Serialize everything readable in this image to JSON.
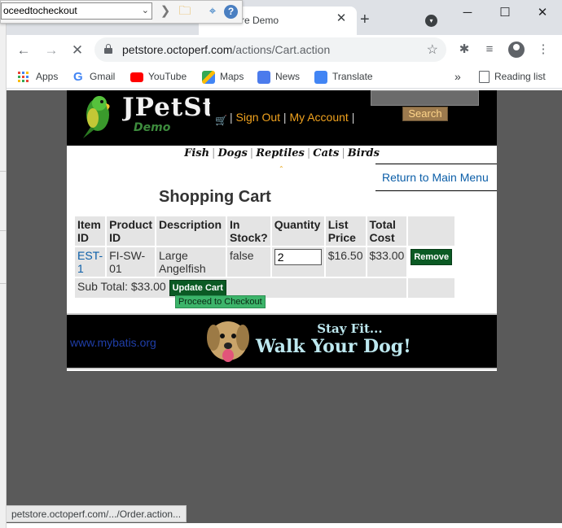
{
  "overlay": {
    "combo_value": "oceedtocheckout"
  },
  "browser": {
    "tab_title": "re Demo",
    "url_host": "petstore.octoperf.com",
    "url_path": "/actions/Cart.action",
    "bookmarks": [
      "Apps",
      "Gmail",
      "YouTube",
      "Maps",
      "News",
      "Translate"
    ],
    "more_label": "»",
    "reading_list": "Reading list",
    "status_url": "petstore.octoperf.com/.../Order.action..."
  },
  "header": {
    "logo_text": "JPetStore",
    "logo_sub": "Demo",
    "sign_out": "Sign Out",
    "my_account": "My Account",
    "sep": "|",
    "search_button": "Search"
  },
  "categories": [
    "Fish",
    "Dogs",
    "Reptiles",
    "Cats",
    "Birds"
  ],
  "return_link": "Return to Main Menu",
  "cart": {
    "title": "Shopping Cart",
    "columns": [
      "Item ID",
      "Product ID",
      "Description",
      "In Stock?",
      "Quantity",
      "List Price",
      "Total Cost",
      ""
    ],
    "rows": [
      {
        "item_id": "EST-1",
        "product_id": "FI-SW-01",
        "description": "Large Angelfish",
        "in_stock": "false",
        "quantity": "2",
        "list_price": "$16.50",
        "total_cost": "$33.00",
        "remove": "Remove"
      }
    ],
    "subtotal": "Sub Total: $33.00",
    "update_button": "Update Cart",
    "checkout_button": "Proceed to Checkout"
  },
  "footer": {
    "mybatis": "www.mybatis.org",
    "banner_line1": "Stay Fit...",
    "banner_line2": "Walk Your Dog!"
  },
  "colors": {
    "header_bg": "#000000",
    "link_orange": "#f0a21e",
    "link_blue": "#0b5ea8",
    "button_dark_green": "#0b5a24",
    "button_light_green": "#3cb46a"
  }
}
